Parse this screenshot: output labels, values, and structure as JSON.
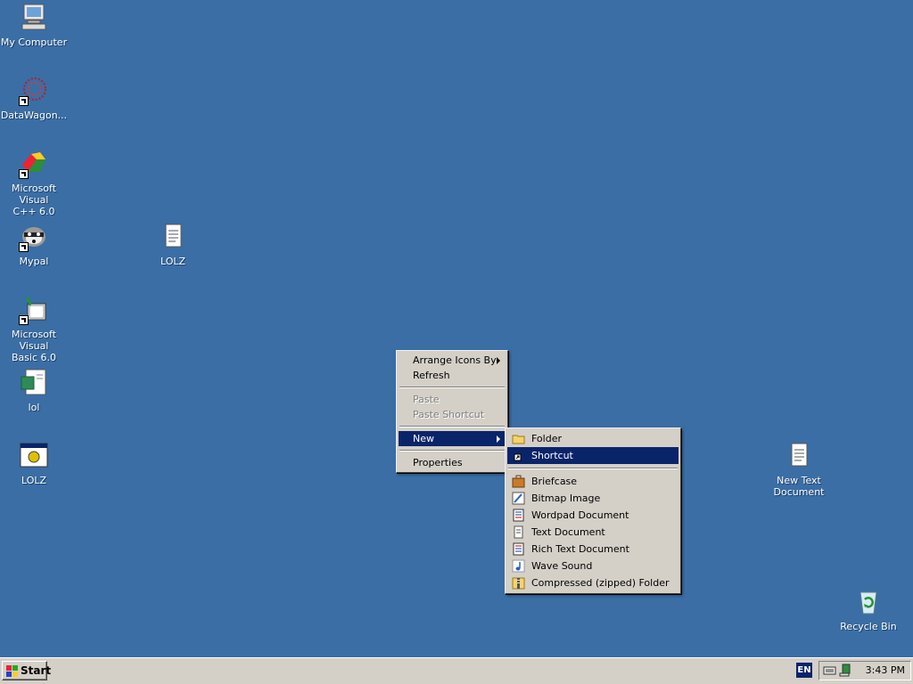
{
  "desktop": {
    "icons": {
      "my_computer": "My Computer",
      "datawagon": "DataWagon...",
      "msvc_line1": "Microsoft Visual",
      "msvc_line2": "C++ 6.0",
      "mypal": "Mypal",
      "lolz_text": "LOLZ",
      "msvb_line1": "Microsoft Visual",
      "msvb_line2": "Basic 6.0",
      "lol": "lol",
      "lolz_app": "LOLZ",
      "new_text_line1": "New Text",
      "new_text_line2": "Document",
      "recycle_bin": "Recycle Bin"
    }
  },
  "context_menu": {
    "arrange_icons_by": "Arrange Icons By",
    "refresh": "Refresh",
    "paste": "Paste",
    "paste_shortcut": "Paste Shortcut",
    "new": "New",
    "properties": "Properties"
  },
  "new_submenu": {
    "folder": "Folder",
    "shortcut": "Shortcut",
    "briefcase": "Briefcase",
    "bitmap_image": "Bitmap Image",
    "wordpad_document": "Wordpad Document",
    "text_document": "Text Document",
    "rich_text_document": "Rich Text Document",
    "wave_sound": "Wave Sound",
    "compressed_folder": "Compressed (zipped) Folder"
  },
  "taskbar": {
    "start": "Start",
    "language": "EN",
    "clock": "3:43 PM"
  },
  "colors": {
    "desktop": "#3a6ea5",
    "menu_face": "#d4d0c8",
    "highlight": "#0a246a"
  }
}
